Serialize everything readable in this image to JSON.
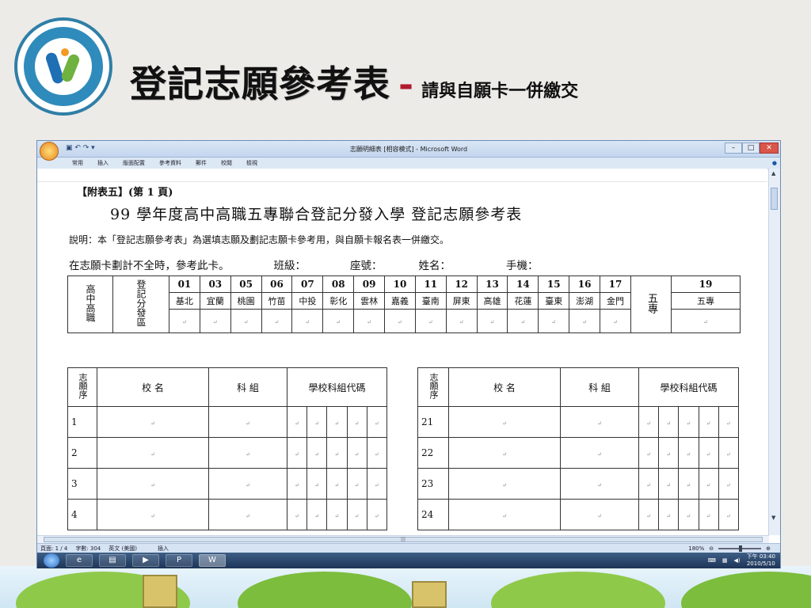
{
  "slide": {
    "title_main": "登記志願參考表",
    "title_dash": "-",
    "title_sub": "請與自願卡一併繳交"
  },
  "window": {
    "title": "志願明細表 [相容模式] - Microsoft Word",
    "quick_access": "▣ ↶ ↷ ▾",
    "tabs": [
      "常用",
      "插入",
      "版面配置",
      "參考資料",
      "郵件",
      "校閱",
      "檢視"
    ],
    "status": {
      "page": "頁面: 1 / 4",
      "words": "字數: 304",
      "language": "英文 (美國)",
      "mode": "插入",
      "zoom": "180%"
    },
    "taskbar": {
      "time": "下午 03:40",
      "date": "2010/5/10"
    }
  },
  "document": {
    "header1": "【附表五】(第 1 頁)",
    "header2": "99 學年度高中高職五專聯合登記分發入學  登記志願參考表",
    "note": "說明：本「登記志願參考表」為選填志願及劃記志願卡參考用，與自願卡報名表一併繳交。",
    "info_line": {
      "card_note": "在志願卡劃計不全時，參考此卡。",
      "class_label": "班級：",
      "seat_label": "座號：",
      "name_label": "姓名：",
      "phone_label": "手機："
    },
    "region_table": {
      "group_label": "高中高職",
      "region_label": "登記分發區",
      "codes": [
        "01",
        "03",
        "05",
        "06",
        "07",
        "08",
        "09",
        "10",
        "11",
        "12",
        "13",
        "14",
        "15",
        "16",
        "17"
      ],
      "names": [
        "基北",
        "宜蘭",
        "桃園",
        "竹苗",
        "中投",
        "彰化",
        "雲林",
        "嘉義",
        "臺南",
        "屏東",
        "高雄",
        "花蓮",
        "臺東",
        "澎湖",
        "金門"
      ],
      "five_label": "五專",
      "five_code": "19",
      "five_name": "五專"
    },
    "choice_table": {
      "col_seq": "志願序",
      "col_school": "校  名",
      "col_dept": "科  組",
      "col_code": "學校科組代碼",
      "left_rows": [
        "1",
        "2",
        "3",
        "4"
      ],
      "right_rows": [
        "21",
        "22",
        "23",
        "24"
      ]
    }
  }
}
